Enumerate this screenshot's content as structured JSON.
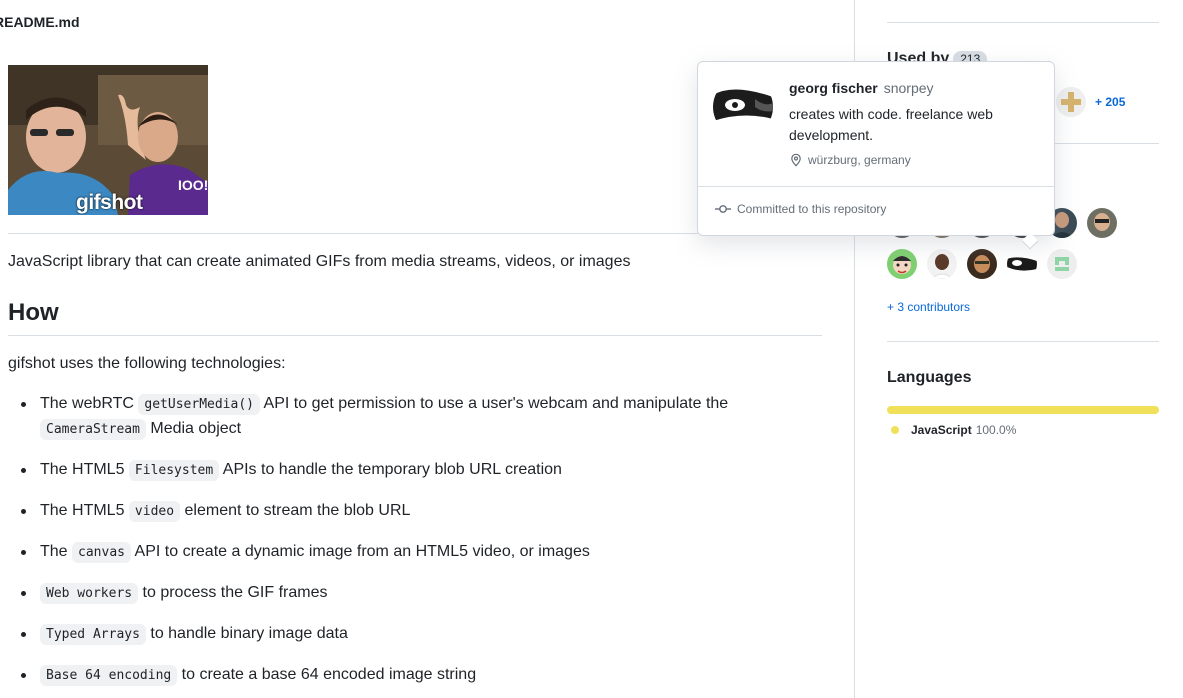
{
  "readme": {
    "filename": "README.md",
    "image_caption": "gifshot",
    "shirt_text": "IOO!",
    "description": "JavaScript library that can create animated GIFs from media streams, videos, or images",
    "how_heading": "How",
    "tech_intro": "gifshot uses the following technologies:",
    "tech_items": [
      {
        "before": "The webRTC ",
        "code": "getUserMedia()",
        "after": " API to get permission to use a user's webcam and manipulate the ",
        "code2": "CameraStream",
        "after2": " Media object"
      },
      {
        "before": "The HTML5 ",
        "code": "Filesystem",
        "after": " APIs to handle the temporary blob URL creation"
      },
      {
        "before": "The HTML5 ",
        "code": "video",
        "after": " element to stream the blob URL"
      },
      {
        "before": "The ",
        "code": "canvas",
        "after": " API to create a dynamic image from an HTML5 video, or images"
      },
      {
        "before": "",
        "code": "Web workers",
        "after": " to process the GIF frames"
      },
      {
        "before": "",
        "code": "Typed Arrays",
        "after": " to handle binary image data"
      },
      {
        "before": "",
        "code": "Base 64 encoding",
        "after": " to create a base 64 encoded image string"
      }
    ]
  },
  "sidebar": {
    "used_by": {
      "title": "Used by",
      "count": "213",
      "more": "+ 205"
    },
    "more_contributors": "+ 3 contributors",
    "languages": {
      "title": "Languages",
      "items": [
        {
          "name": "JavaScript",
          "percent": "100.0%",
          "fraction": 1.0,
          "color": "#f1e05a"
        }
      ]
    }
  },
  "hovercard": {
    "name": "georg fischer",
    "login": "snorpey",
    "bio": "creates with code. freelance web development.",
    "location": "würzburg, germany",
    "footer": "Committed to this repository"
  },
  "colors": {
    "link": "#0969da",
    "border": "#d8dee4",
    "javascript": "#f1e05a"
  }
}
